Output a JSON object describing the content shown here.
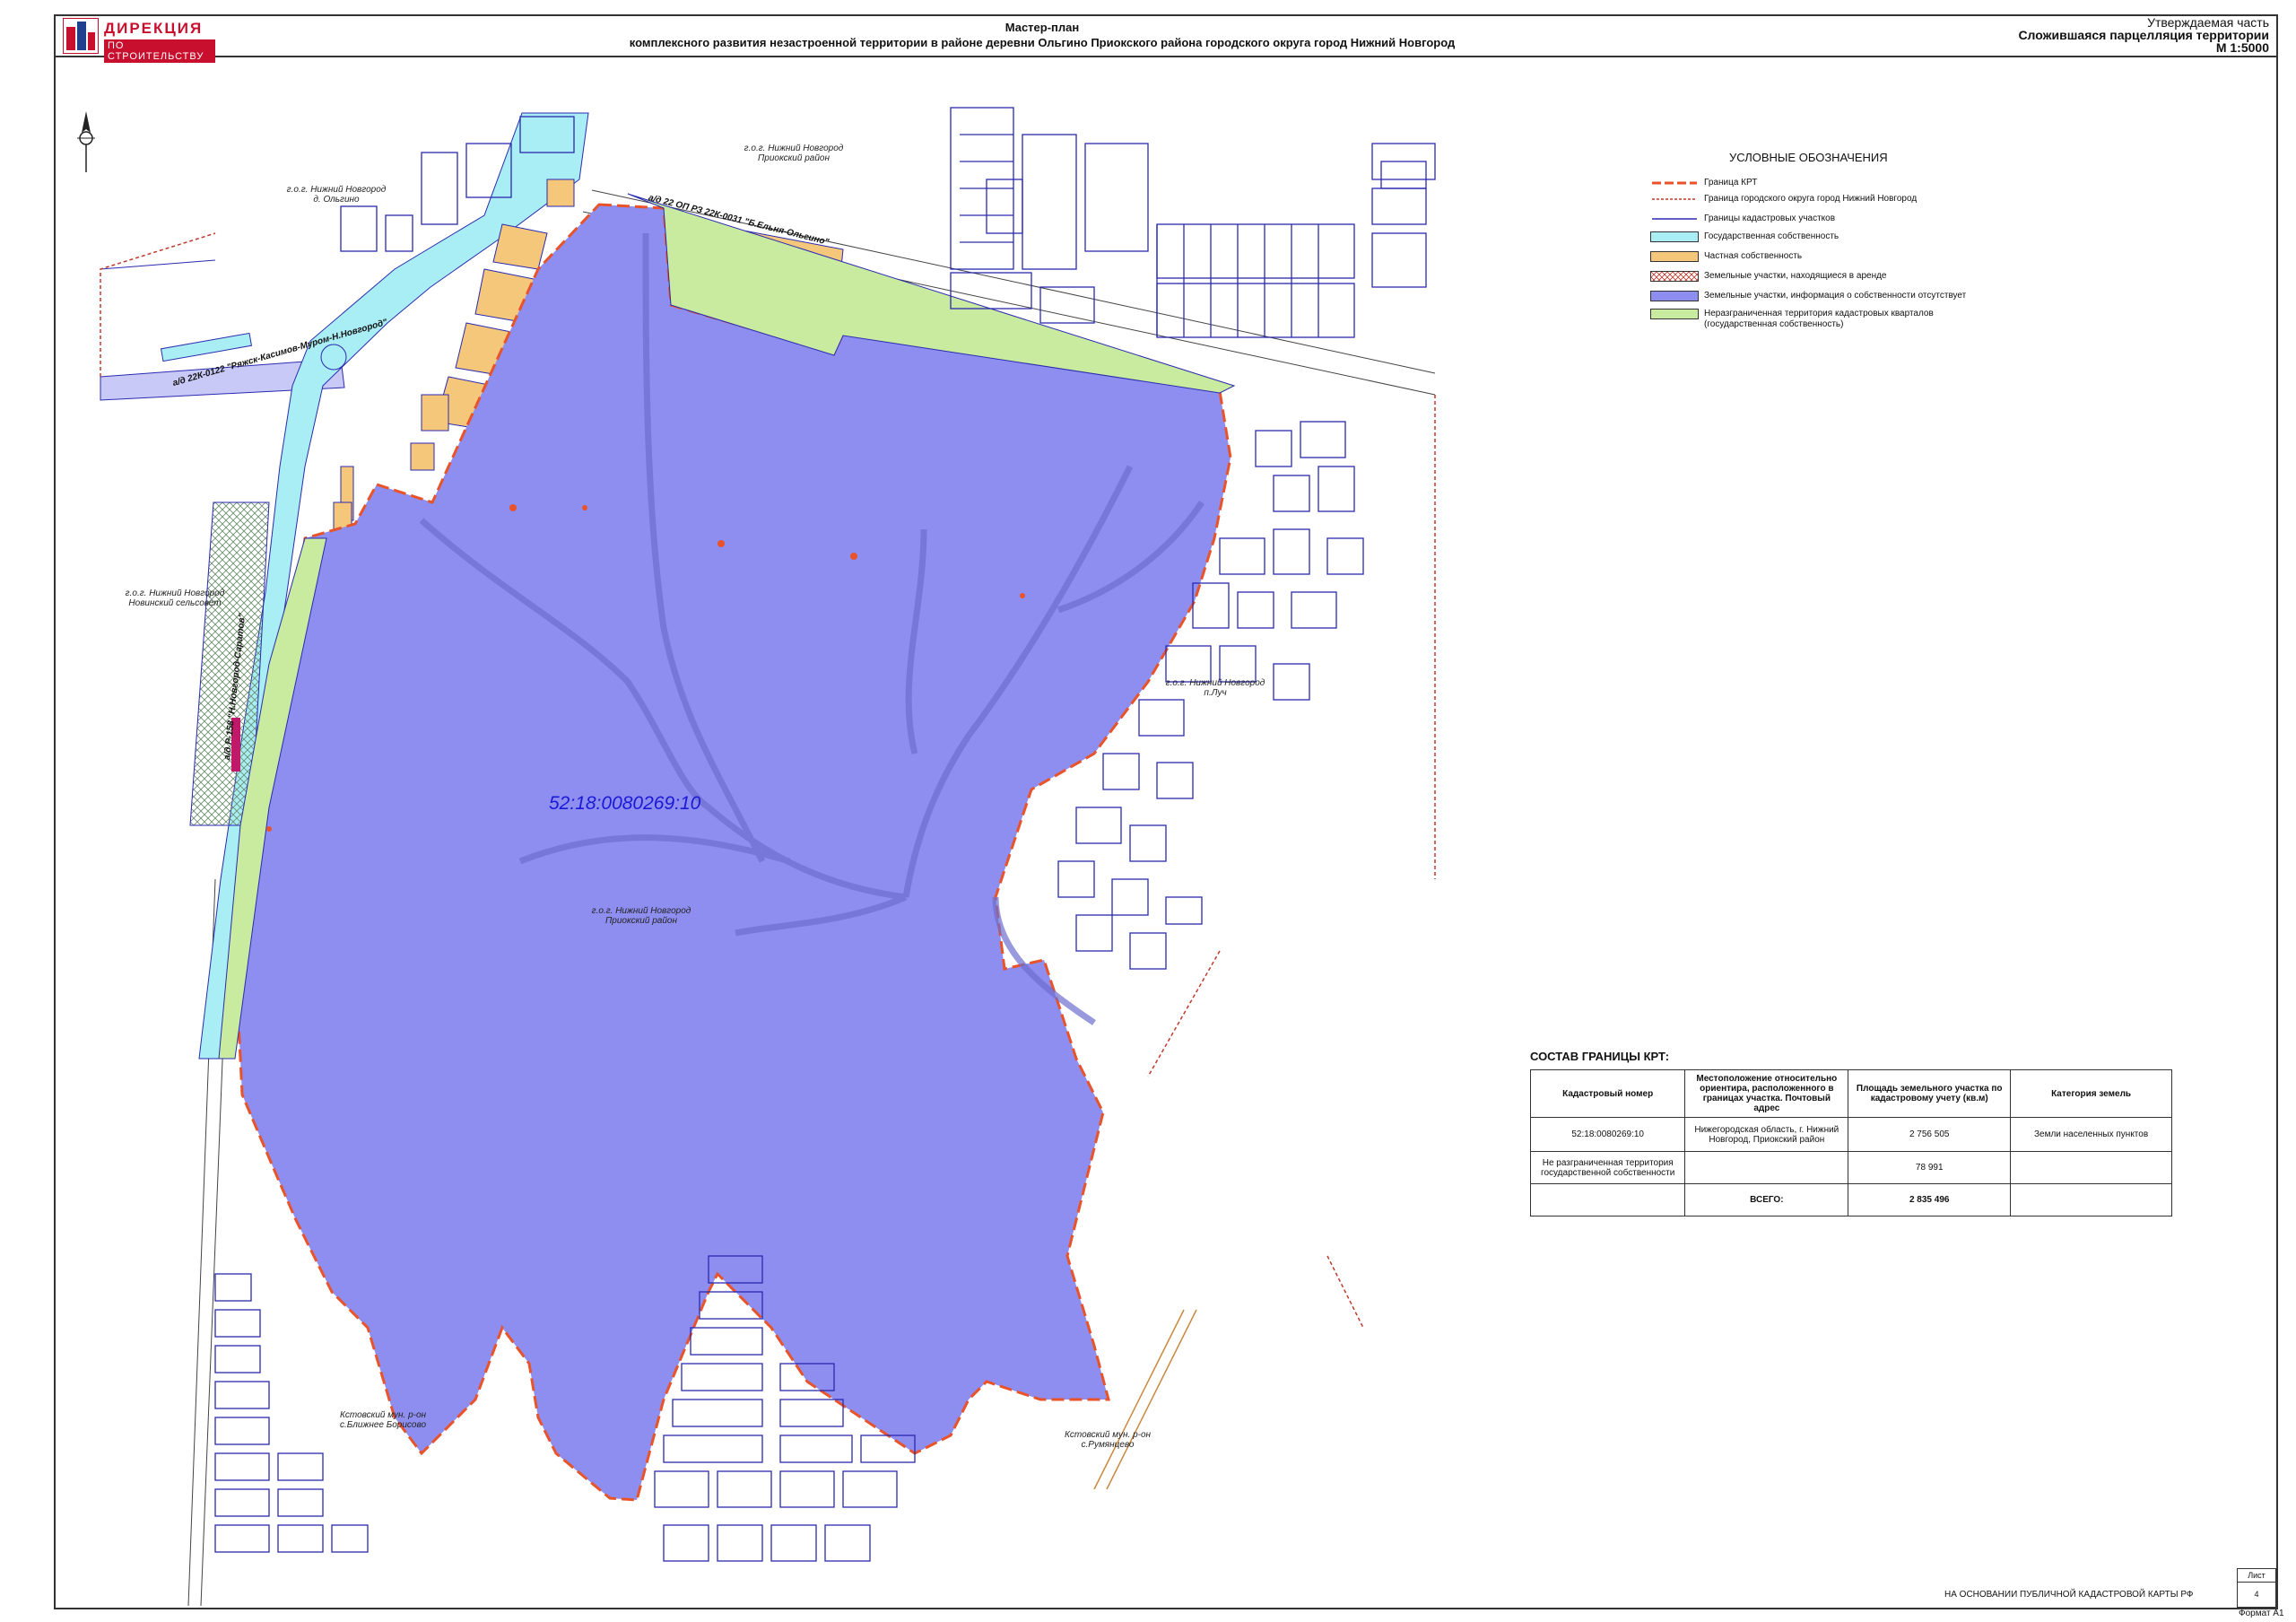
{
  "header": {
    "title_line1": "Мастер-план",
    "title_line2": "комплексного развития незастроенной территории в районе деревни Ольгино Приокского района городского округа город Нижний Новгород",
    "right_line1": "Утверждаемая часть",
    "right_line2": "Сложившаяся парцелляция территории",
    "right_line3": "М 1:5000",
    "logo_line1": "ДИРЕКЦИЯ",
    "logo_line2": "ПО СТРОИТЕЛЬСТВУ"
  },
  "map": {
    "cadastral_number": "52:18:0080269:10",
    "labels": [
      {
        "id": "olgino",
        "lines": [
          "г.о.г. Нижний Новгород",
          "д. Ольгино"
        ]
      },
      {
        "id": "priok_top",
        "lines": [
          "г.о.г. Нижний Новгород",
          "Приокский район"
        ]
      },
      {
        "id": "novinki",
        "lines": [
          "г.о.г. Нижний Новгород",
          "Новинский сельсовет"
        ]
      },
      {
        "id": "luch",
        "lines": [
          "г.о.г. Нижний Новгород",
          "п.Луч"
        ]
      },
      {
        "id": "priok_center",
        "lines": [
          "г.о.г. Нижний Новгород",
          "Приокский район"
        ]
      },
      {
        "id": "borisovo",
        "lines": [
          "Кстовский мун. р-он",
          "с.Ближнее Борисово"
        ]
      },
      {
        "id": "rumyantsevo",
        "lines": [
          "Кстовский мун. р-он",
          "с.Румянцево"
        ]
      }
    ],
    "roads": [
      {
        "id": "road1",
        "text": "а/д 22К-0122 \"Ряжск-Касимов-Муром-Н.Новгород\""
      },
      {
        "id": "road2",
        "text": "а/д 22 ОП РЗ 22К-0031 \"Б.Ельня-Ольгино\""
      },
      {
        "id": "road3",
        "text": "а/д Р-158 \"Н.Новгород-Саратов\""
      }
    ]
  },
  "legend": {
    "title": "УСЛОВНЫЕ ОБОЗНАЧЕНИЯ",
    "items": [
      {
        "label": "Граница КРТ",
        "color": "#e8532a"
      },
      {
        "label": "Граница городского округа город Нижний Новгород",
        "color": "#c0392b"
      },
      {
        "label": "Границы кадастровых участков",
        "color": "#2a2ab0"
      },
      {
        "label": "Государственная собственность",
        "color": "#a9eef4"
      },
      {
        "label": "Частная собственность",
        "color": "#f5c77a"
      },
      {
        "label": "Земельные участки, находящиеся в аренде",
        "color": "#e06a6a"
      },
      {
        "label": "Земельные участки, информация о собственности отсутствует",
        "color": "#8e8ef0"
      },
      {
        "label": "Неразграниченная территория кадастровых кварталов (государственная собственность)",
        "color": "#c9eba0"
      }
    ]
  },
  "composition": {
    "title": "СОСТАВ ГРАНИЦЫ КРТ:",
    "columns": [
      "Кадастровый номер",
      "Местоположение относительно ориентира, расположенного в границах участка. Почтовый адрес",
      "Площадь земельного участка по кадастровому учету (кв.м)",
      "Категория земель"
    ],
    "rows": [
      [
        "52:18:0080269:10",
        "Нижегородская область, г. Нижний Новгород, Приокский район",
        "2 756 505",
        "Земли населенных пунктов"
      ],
      [
        "Не разграниченная территория государственной собственности",
        "",
        "78 991",
        ""
      ]
    ],
    "total_label": "ВСЕГО:",
    "total_value": "2 835 496"
  },
  "footer": {
    "basis": "НА ОСНОВАНИИ ПУБЛИЧНОЙ КАДАСТРОВОЙ КАРТЫ РФ",
    "sheet_label": "Лист",
    "sheet_number": "4",
    "format": "Формат А1"
  }
}
